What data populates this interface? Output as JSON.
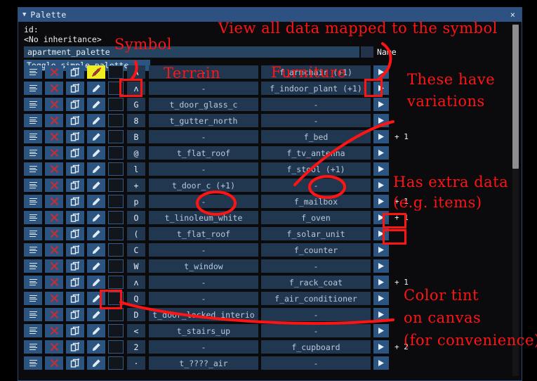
{
  "window": {
    "title": "Palette",
    "caret_icon": "caret-down-icon",
    "close_label": "×"
  },
  "header": {
    "id_label": "id:",
    "inheritance": "<No inheritance>",
    "palette_name": "apartment_palette",
    "name_column_label": "Name",
    "toggle_label": "Toggle simple palette"
  },
  "icons": {
    "menu": "hamburger-menu-icon",
    "delete": "✕",
    "duplicate": "duplicate-icon",
    "edit": "pencil-icon",
    "edit_disabled": "pencil-disabled-icon",
    "arrow": "▶"
  },
  "colors": {
    "accent": "#2c5480",
    "cell": "#20374f",
    "annotation": "#ff1414",
    "edit_off_bg": "#eeee22",
    "title_bar": "#2d5180"
  },
  "columns": {
    "symbol": "Symbol",
    "terrain": "Terrain",
    "furniture": "Furniture"
  },
  "rows": [
    {
      "symbol": "A",
      "terrain": "-",
      "furniture": "f_armchair (+1)",
      "extra": ""
    },
    {
      "symbol": "ʌ",
      "terrain": "-",
      "furniture": "f_indoor_plant (+1)",
      "extra": ""
    },
    {
      "symbol": "G",
      "terrain": "t_door_glass_c",
      "furniture": "-",
      "extra": ""
    },
    {
      "symbol": "8",
      "terrain": "t_gutter_north",
      "furniture": "-",
      "extra": ""
    },
    {
      "symbol": "B",
      "terrain": "-",
      "furniture": "f_bed",
      "extra": "+ 1"
    },
    {
      "symbol": "@",
      "terrain": "t_flat_roof",
      "furniture": "f_tv_antenna",
      "extra": ""
    },
    {
      "symbol": "l",
      "terrain": "-",
      "furniture": "f_stool (+1)",
      "extra": ""
    },
    {
      "symbol": "+",
      "terrain": "t_door_c (+1)",
      "furniture": "-",
      "extra": ""
    },
    {
      "symbol": "p",
      "terrain": "-",
      "furniture": "f_mailbox",
      "extra": "+ 1"
    },
    {
      "symbol": "O",
      "terrain": "t_linoleum_white",
      "furniture": "f_oven",
      "extra": "+ 1"
    },
    {
      "symbol": "(",
      "terrain": "t_flat_roof",
      "furniture": "f_solar_unit",
      "extra": ""
    },
    {
      "symbol": "C",
      "terrain": "-",
      "furniture": "f_counter",
      "extra": ""
    },
    {
      "symbol": "W",
      "terrain": "t_window",
      "furniture": "-",
      "extra": ""
    },
    {
      "symbol": "ʌ",
      "terrain": "-",
      "furniture": "f_rack_coat",
      "extra": "+ 1"
    },
    {
      "symbol": "Q",
      "terrain": "-",
      "furniture": "f_air_conditioner",
      "extra": ""
    },
    {
      "symbol": "D",
      "terrain": "t_door_locked_interio",
      "furniture": "-",
      "extra": ""
    },
    {
      "symbol": "<",
      "terrain": "t_stairs_up",
      "furniture": "-",
      "extra": ""
    },
    {
      "symbol": "2",
      "terrain": "-",
      "furniture": "f_cupboard",
      "extra": "+ 2"
    },
    {
      "symbol": "·",
      "terrain": "t_????_air",
      "furniture": "-",
      "extra": ""
    }
  ],
  "annotations": {
    "view_all": "View all data mapped to the symbol",
    "symbol": "Symbol",
    "terrain": "Terrain",
    "furniture": "Furniture",
    "variations_line1": "These have",
    "variations_line2": "variations",
    "extra_line1": "Has extra data",
    "extra_line2": "(e.g. items)",
    "tint_line1": "Color tint",
    "tint_line2": "on canvas",
    "tint_line3": "(for convenience)"
  }
}
